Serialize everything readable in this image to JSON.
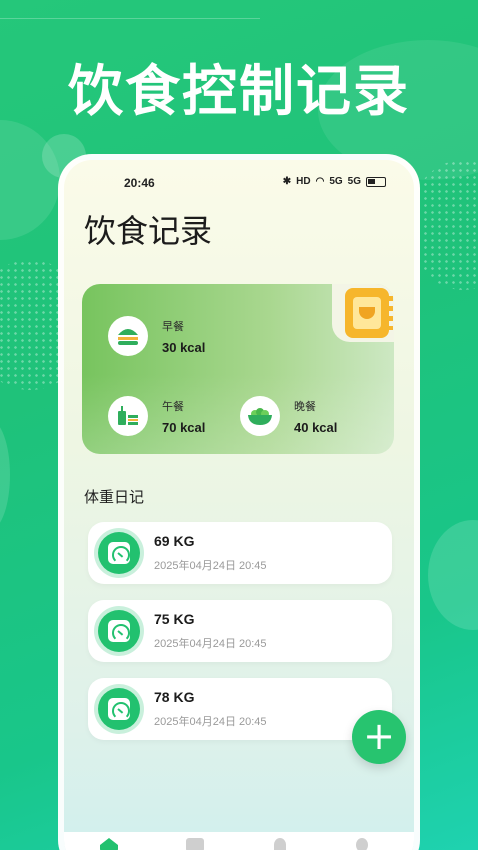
{
  "promo": {
    "headline": "饮食控制记录"
  },
  "status_bar": {
    "time": "20:46",
    "network": "HD",
    "signal1": "5G",
    "signal2": "5G"
  },
  "page": {
    "title": "饮食记录"
  },
  "meals": {
    "breakfast": {
      "label": "早餐",
      "kcal": "30 kcal",
      "icon": "burger-icon"
    },
    "lunch": {
      "label": "午餐",
      "kcal": "70 kcal",
      "icon": "fastfood-icon"
    },
    "dinner": {
      "label": "晚餐",
      "kcal": "40 kcal",
      "icon": "salad-bowl-icon"
    },
    "book_icon": "recipe-book-icon"
  },
  "weight_diary": {
    "title": "体重日记",
    "entries": [
      {
        "value": "69 KG",
        "date": "2025年04月24日 20:45"
      },
      {
        "value": "75 KG",
        "date": "2025年04月24日 20:45"
      },
      {
        "value": "78 KG",
        "date": "2025年04月24日 20:45"
      }
    ]
  },
  "fab": {
    "label": "+"
  },
  "colors": {
    "brand_green": "#22c16f",
    "meal_card": "#77c45e",
    "book": "#f6b62c"
  }
}
